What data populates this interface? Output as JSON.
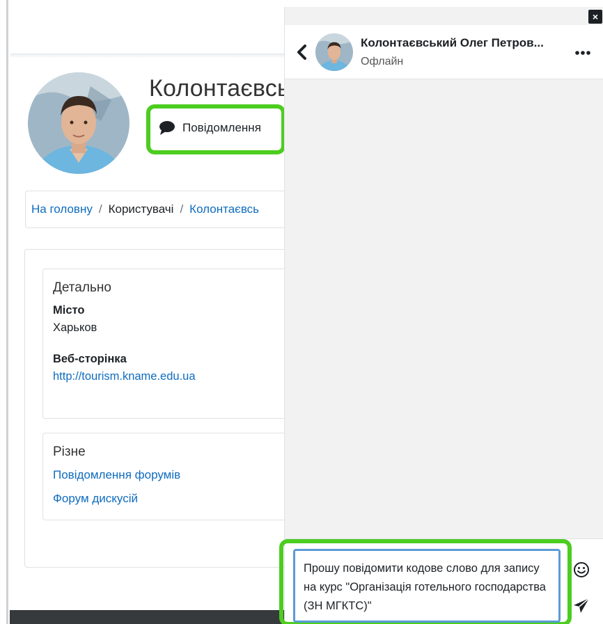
{
  "profile": {
    "name_heading": "Колонтаєвсь",
    "message_button_label": "Повідомлення"
  },
  "breadcrumb": {
    "home": "На головну",
    "users": "Користувачі",
    "current": "Колонтаєвсь",
    "separator": "/"
  },
  "details": {
    "title": "Детально",
    "city_label": "Місто",
    "city_value": "Харьков",
    "website_label": "Веб-сторінка",
    "website_value": "http://tourism.kname.edu.ua"
  },
  "misc": {
    "title": "Різне",
    "links": [
      "Повідомлення форумів",
      "Форум дискусій"
    ]
  },
  "drawer": {
    "close_label": "×",
    "contact_name": "Колонтаєвський Олег Петров...",
    "contact_status": "Офлайн",
    "message_text": "Прошу повідомити кодове слово для запису на курс \"Організація готельного господарства (ЗН МГКТС)\""
  },
  "colors": {
    "link": "#0f6cbf",
    "highlight": "#4ccd1f",
    "textarea_border": "#5b9bd5",
    "drawer_bg": "#f2f2f2"
  },
  "icons": {
    "message_button": "speech-bubble-icon",
    "back": "chevron-left-icon",
    "more": "more-dots-icon",
    "emoji": "smiley-icon",
    "send": "paper-plane-icon",
    "close": "close-icon"
  }
}
